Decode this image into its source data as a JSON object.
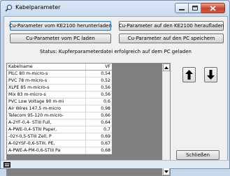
{
  "window": {
    "title": "Kabelparameter"
  },
  "buttons": {
    "download_ke": "Cu-Parameter vom KE2100 herunterladen",
    "upload_ke": "Cu-Parameter auf den KE2100 heraufladen",
    "load_pc": "Cu-Parameter vom PC laden",
    "save_pc": "Cu-Parameter auf den PC speichern",
    "close": "Schließen"
  },
  "status": {
    "text": "Status: Kupferparameterdatei erfolgreich auf dem PC geladen"
  },
  "table": {
    "columns": [
      "Kabelname",
      "VF"
    ],
    "rows": [
      {
        "name": "PILC 80 m-micro-s",
        "vf": "0,54"
      },
      {
        "name": "PVC 78 m-micro-s",
        "vf": "0,52"
      },
      {
        "name": "XLPE 85 m-micro-s",
        "vf": "0,56"
      },
      {
        "name": "Mix 83 m-micro-s",
        "vf": "0,56"
      },
      {
        "name": "PVC Low Voltage 90 m-mi",
        "vf": "0,6"
      },
      {
        "name": "Air Wires 147,5 m-micro",
        "vf": "0,98"
      },
      {
        "name": "Telecom 95-120 m-micro-",
        "vf": "0,66"
      },
      {
        "name": "A-2YF-0,4- STIII Full,",
        "vf": "0,64"
      },
      {
        "name": "A-PWE-0,4-STIII Paper,",
        "vf": "0,7"
      },
      {
        "name": "-02Y-0,5-STIII Zell, P",
        "vf": "0,69"
      },
      {
        "name": "A-02YSF-0,6-STIII, PE,",
        "vf": "0,67"
      },
      {
        "name": "A-PWE-A-PM-0,6-STIII Pa",
        "vf": "0,68"
      }
    ]
  },
  "colors": {
    "window_frame": "#c5d7ee",
    "table_empty_area": "#808080",
    "close_button": "#c4452e"
  }
}
